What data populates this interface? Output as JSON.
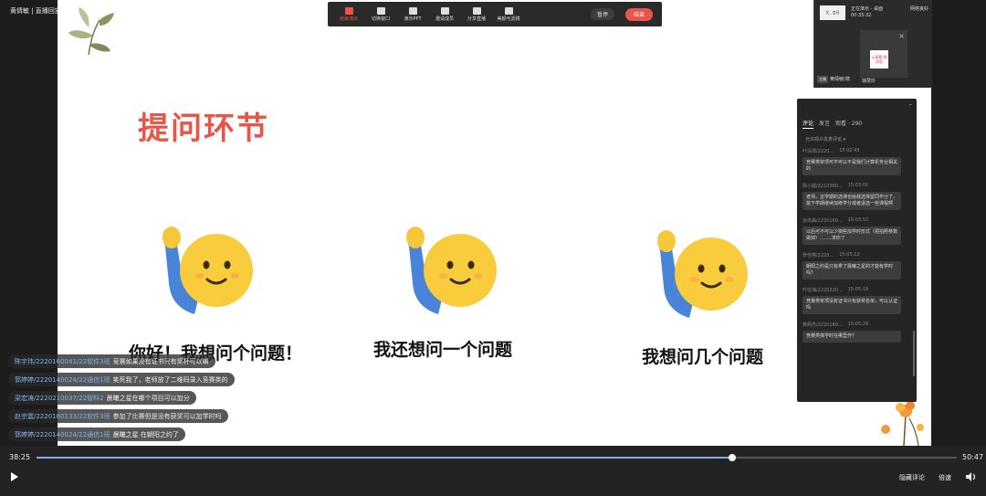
{
  "window": {
    "title": "黄倩敏 | 直播回放"
  },
  "slide": {
    "title": "提问环节",
    "captions": [
      "你好！我想问个问题！",
      "我还想问一个问题",
      "我想问几个问题"
    ]
  },
  "toolbar": {
    "tools": [
      {
        "label": "结束演示",
        "icon": "present-icon",
        "active": true
      },
      {
        "label": "切换窗口",
        "icon": "window-icon",
        "active": false
      },
      {
        "label": "演示PPT",
        "icon": "ppt-icon",
        "active": false
      },
      {
        "label": "邀请成员",
        "icon": "invite-icon",
        "active": false
      },
      {
        "label": "分享直播",
        "icon": "share-icon",
        "active": false
      },
      {
        "label": "美颜与滤镜",
        "icon": "beauty-icon",
        "active": false
      }
    ],
    "pause_label": "暂停",
    "end_label": "结束"
  },
  "video_panel": {
    "status": "正在演示 - 桌面",
    "time": "00:35:32",
    "network": "网络良好",
    "host_tag": "主播",
    "host_name": "黄倩敏(歇",
    "sub_name": "徐慧玲",
    "sub_card_text": "认真看 群消息",
    "thumb_text": "文_ 会员"
  },
  "comments": {
    "tabs": [
      "评论",
      "发言",
      "观看 · 290"
    ],
    "allow_text": "允许观众发表评论",
    "items": [
      {
        "user": "叶清漫/2220...",
        "time": "15:02:45",
        "text": "竞赛类奖项可不可以不是我们计算机专业相关的"
      },
      {
        "user": "陈小威/2210360...",
        "time": "15:03:01",
        "text": "老师，这学期的选课也给我选择留同学分了，能下学期继续加修学分或者退选一些课程啊"
      },
      {
        "user": "余依曲/2220160...",
        "time": "15:03:52",
        "text": "以后可不可以少搞些加学时形式（把拍照参数做掉）........求你了"
      },
      {
        "user": "罗佳燕/2220...",
        "time": "15:05:12",
        "text": "朝阳之约是只有拿了晨曦之星的才能有学时吗？"
      },
      {
        "user": "叶征海/2220220...",
        "time": "15:05:18",
        "text": "竞赛类奖项没有证书只有获奖名单，可以认证吗"
      },
      {
        "user": "黄熙杰/2220160...",
        "time": "15:05:29",
        "text": "竞赛类抹学时在哪里作？"
      }
    ]
  },
  "danmaku": [
    {
      "user": "陈宇玮/2220160041/22软件3班",
      "text": "竞赛如果没有证书只有奖杯可以嘛"
    },
    {
      "user": "郭婷婷/2220140024/22通信1班",
      "text": "笑死我了，老师放了二维码录入竞赛类的"
    },
    {
      "user": "梁宏涛/2220210037/22智科2",
      "text": "晨曦之星在哪个项目可以加分"
    },
    {
      "user": "赵宗震/2220160133/22软件3班",
      "text": "参加了比赛但是没有获奖可以加学时吗"
    },
    {
      "user": "郭婷婷/2220140024/22通信1班",
      "text": "晨曦之星    在朝阳之约了"
    }
  ],
  "player": {
    "current": "38:25",
    "total": "50:47",
    "progress": 0.756,
    "hide_comments_label": "隐藏评论",
    "speed_label": "倍速"
  }
}
